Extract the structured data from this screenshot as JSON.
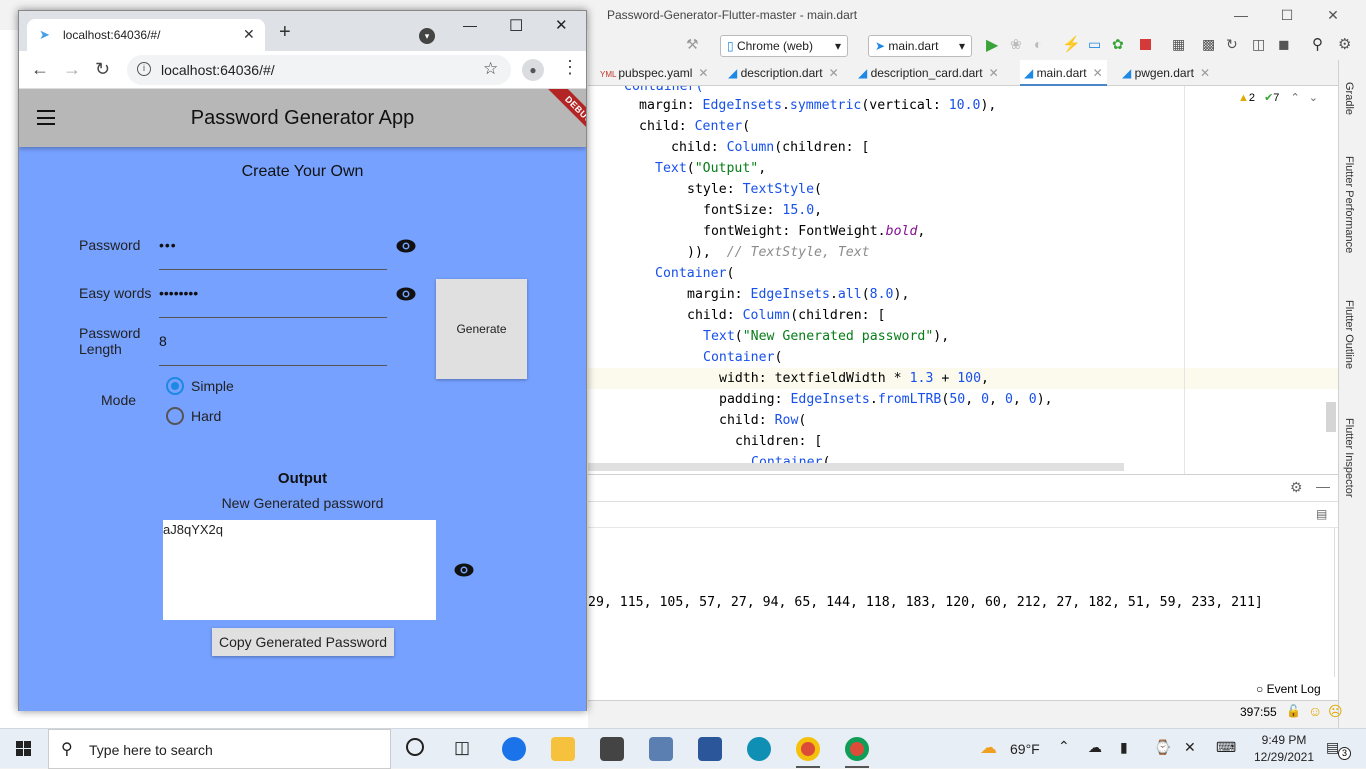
{
  "ide": {
    "title": "Password-Generator-Flutter-master - main.dart",
    "device_select": "Chrome (web)",
    "config_select": "main.dart",
    "tabs": [
      {
        "label": "pubspec.yaml"
      },
      {
        "label": "description.dart"
      },
      {
        "label": "description_card.dart"
      },
      {
        "label": "main.dart"
      },
      {
        "label": "pwgen.dart"
      }
    ],
    "inspection": {
      "warnings": "2",
      "ok": "7"
    },
    "right_tabs": [
      "Gradle",
      "Flutter Performance",
      "Flutter Outline",
      "Flutter Inspector"
    ],
    "code": {
      "l0": "Container(",
      "l1a": "margin: ",
      "l1b": "EdgeInsets",
      "l1c": ".",
      "l1d": "symmetric",
      "l1e": "(vertical: ",
      "l1f": "10.0",
      "l1g": "),",
      "l2a": "child: ",
      "l2b": "Center",
      "l2c": "(",
      "l3a": "child: ",
      "l3b": "Column",
      "l3c": "(children: [",
      "l4a": "Text",
      "l4b": "(",
      "l4c": "\"Output\"",
      "l4d": ",",
      "l5a": "style: ",
      "l5b": "TextStyle",
      "l5c": "(",
      "l6a": "fontSize: ",
      "l6b": "15.0",
      "l6c": ",",
      "l7a": "fontWeight: FontWeight.",
      "l7b": "bold",
      "l7c": ",",
      "l8a": ")),  ",
      "l8b": "// TextStyle, Text",
      "l9a": "Container",
      "l9b": "(",
      "l10a": "margin: ",
      "l10b": "EdgeInsets",
      "l10c": ".",
      "l10d": "all",
      "l10e": "(",
      "l10f": "8.0",
      "l10g": "),",
      "l11a": "child: ",
      "l11b": "Column",
      "l11c": "(children: [",
      "l12a": "Text",
      "l12b": "(",
      "l12c": "\"New Generated password\"",
      "l12d": "),",
      "l13a": "Container",
      "l13b": "(",
      "l14a": "width: textfieldWidth * ",
      "l14b": "1.3",
      "l14c": " + ",
      "l14d": "100",
      "l14e": ",",
      "l15a": "padding: ",
      "l15b": "EdgeInsets",
      "l15c": ".",
      "l15d": "fromLTRB",
      "l15e": "(",
      "l15f": "50",
      "l15g": ", ",
      "l15h": "0",
      "l15i": ", ",
      "l15j": "0",
      "l15k": ", ",
      "l15l": "0",
      "l15m": "),",
      "l16a": "child: ",
      "l16b": "Row",
      "l16c": "(",
      "l17": "children: [",
      "l18a": "Container",
      "l18b": "("
    },
    "console": "29, 115, 105, 57, 27, 94, 65, 144, 118, 183, 120, 60, 212, 27, 182, 51, 59, 233, 211]",
    "event_log": "Event Log",
    "cursor_pos": "397:55"
  },
  "chrome": {
    "tab_title": "localhost:64036/#/",
    "url": "localhost:64036/#/"
  },
  "app": {
    "title": "Password Generator App",
    "debug": "DEBUG",
    "section_title": "Create Your Own",
    "password_label": "Password",
    "password_value": "•••",
    "easy_words_label": "Easy words",
    "easy_words_value": "••••••••",
    "length_label_1": "Password",
    "length_label_2": "Length",
    "length_value": "8",
    "generate_label": "Generate",
    "mode_label": "Mode",
    "mode_options": [
      {
        "label": "Simple",
        "selected": true
      },
      {
        "label": "Hard",
        "selected": false
      }
    ],
    "output_title": "Output",
    "output_subtitle": "New Generated password",
    "output_value": "aJ8qYX2q",
    "copy_label": "Copy Generated Password"
  },
  "taskbar": {
    "search_placeholder": "Type here to search",
    "weather": "69°F",
    "time": "9:49 PM",
    "date": "12/29/2021",
    "notifications": "3"
  },
  "colors": {
    "app_bg": "#76a1ff",
    "appbar": "#b7b7b7",
    "radio_accent": "#1e88e5",
    "debug": "#b32525"
  }
}
